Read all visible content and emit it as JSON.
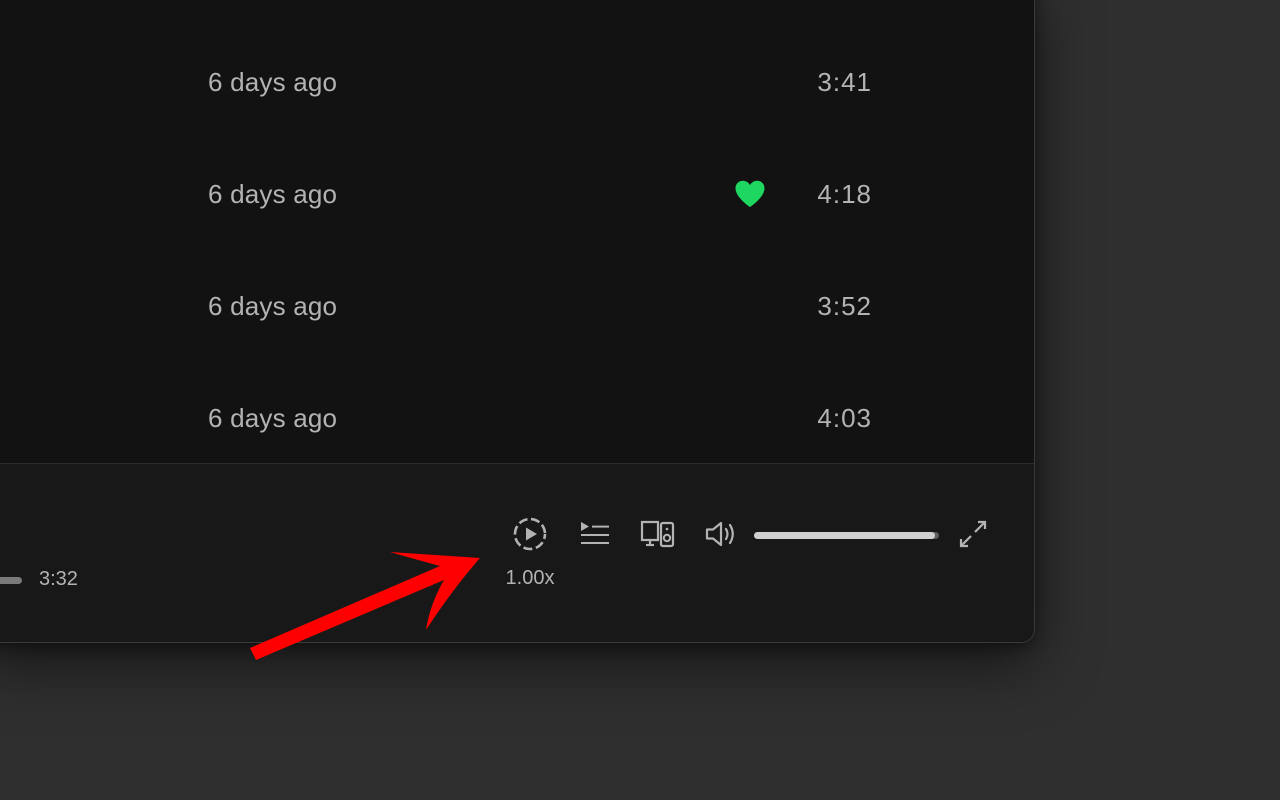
{
  "tracks": [
    {
      "date_added": "6 days ago",
      "duration": "3:41",
      "liked": false
    },
    {
      "date_added": "6 days ago",
      "duration": "4:18",
      "liked": true
    },
    {
      "date_added": "6 days ago",
      "duration": "3:52",
      "liked": false
    },
    {
      "date_added": "6 days ago",
      "duration": "4:03",
      "liked": false
    }
  ],
  "player": {
    "total_time": "3:32",
    "playback_speed_label": "1.00x",
    "volume_level": 0.98,
    "icons": {
      "playback_speed": "playback-speed-icon",
      "queue": "queue-icon",
      "connect_device": "connect-device-icon",
      "volume": "volume-icon",
      "fullscreen": "fullscreen-icon",
      "liked": "heart-icon"
    }
  },
  "colors": {
    "background": "#2f2f2f",
    "window": "#121212",
    "player_bar": "#181818",
    "text_secondary": "#b3b3b3",
    "accent_green": "#1ed760",
    "annotation_red": "#ff0000"
  }
}
